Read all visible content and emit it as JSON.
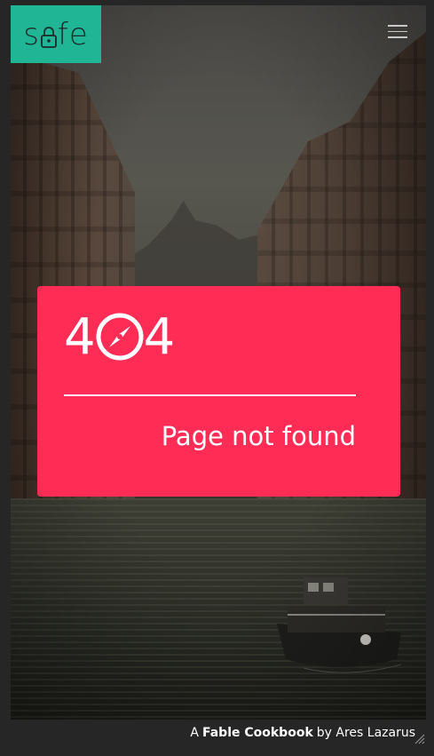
{
  "header": {
    "logo_text_a": "s",
    "logo_text_b": "fe",
    "menu_icon": "hamburger-menu-icon"
  },
  "error": {
    "code_left": "4",
    "code_right": "4",
    "code_icon": "compass-icon",
    "message": "Page not found"
  },
  "footer": {
    "prefix": "A",
    "product": "Fable Cookbook",
    "by": "by Ares Lazarus"
  },
  "colors": {
    "logo_bg": "#1fb595",
    "card_bg": "#ff2d55",
    "footer_bg": "#262626"
  }
}
